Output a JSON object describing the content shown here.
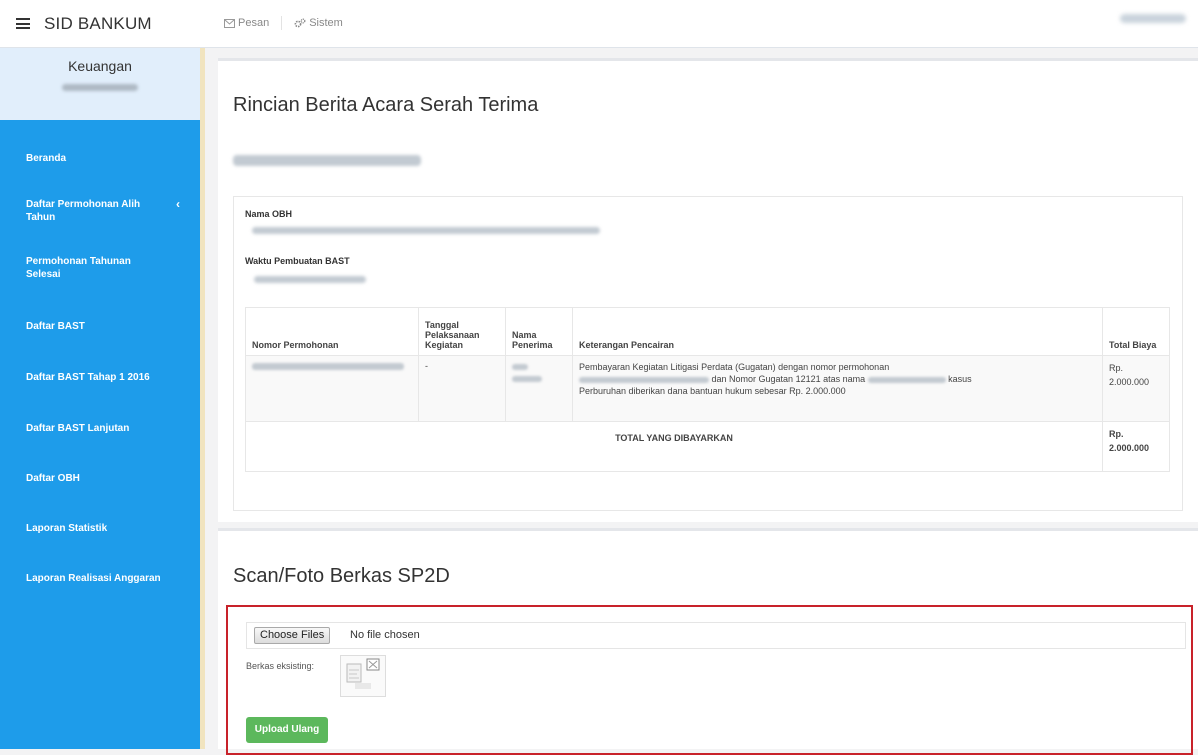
{
  "app": {
    "brand": "SID BANKUM"
  },
  "topbar": {
    "menu": [
      {
        "label": "Pesan",
        "icon": "envelope-icon"
      },
      {
        "label": "Sistem",
        "icon": "gears-icon"
      }
    ],
    "user_label": ""
  },
  "sidebar": {
    "title": "Keuangan",
    "items": [
      {
        "label": "Beranda"
      },
      {
        "label": "Daftar Permohonan Alih Tahun",
        "chevron": "‹"
      },
      {
        "label": "Permohonan Tahunan Selesai"
      },
      {
        "label": "Daftar BAST"
      },
      {
        "label": "Daftar BAST Tahap 1 2016"
      },
      {
        "label": "Daftar BAST Lanjutan"
      },
      {
        "label": "Daftar OBH"
      },
      {
        "label": "Laporan Statistik"
      },
      {
        "label": "Laporan Realisasi Anggaran"
      }
    ]
  },
  "detail": {
    "title": "Rincian Berita Acara Serah Terima",
    "obh_label": "Nama OBH",
    "waktu_label": "Waktu Pembuatan BAST",
    "table": {
      "headers": [
        "Nomor Permohonan",
        "Tanggal Pelaksanaan Kegiatan",
        "Nama Penerima",
        "Keterangan Pencairan",
        "Total Biaya"
      ],
      "row": {
        "tanggal": "-",
        "keterangan_1": "Pembayaran Kegiatan Litigasi Perdata (Gugatan) dengan nomor permohonan",
        "keterangan_2": "dan Nomor Gugatan 12121 atas nama",
        "keterangan_3": "kasus",
        "keterangan_4": "Perburuhan diberikan dana bantuan hukum sebesar Rp. 2.000.000",
        "total": "Rp. 2.000.000"
      },
      "total_label": "TOTAL YANG DIBAYARKAN",
      "total_value": "Rp. 2.000.000"
    }
  },
  "upload": {
    "title": "Scan/Foto Berkas SP2D",
    "choose_label": "Choose Files",
    "no_file": "No file chosen",
    "existing_label": "Berkas eksisting:",
    "button": "Upload Ulang"
  },
  "colors": {
    "sidebar": "#1e9cea",
    "sidebar_head": "#e1eefb",
    "upload_button": "#5cb85c",
    "highlight_border": "#c8222a"
  }
}
